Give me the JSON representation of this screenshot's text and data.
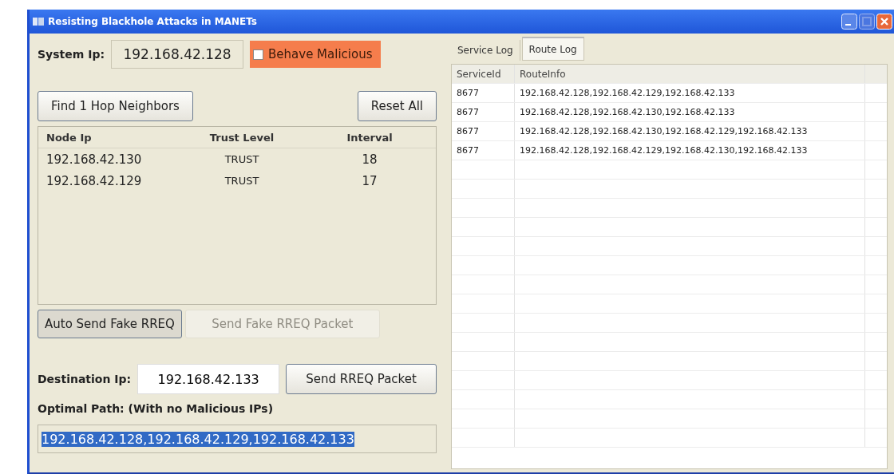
{
  "window": {
    "title": "Resisting Blackhole Attacks in MANETs"
  },
  "system_ip": {
    "label": "System Ip:",
    "value": "192.168.42.128"
  },
  "behave_malicious": {
    "label": "Behave Malicious",
    "checked": false
  },
  "buttons_top": [
    {
      "label": "Find 1 Hop Neighbors",
      "disabled": false
    },
    {
      "label": "Reset All",
      "disabled": false
    }
  ],
  "neighbors": {
    "columns": [
      "Node Ip",
      "Trust Level",
      "Interval"
    ],
    "rows": [
      [
        "192.168.42.130",
        "TRUST",
        "18"
      ],
      [
        "192.168.42.129",
        "TRUST",
        "17"
      ]
    ]
  },
  "buttons_fake": [
    {
      "label": "Auto Send Fake RREQ",
      "disabled": false
    },
    {
      "label": "Send Fake RREQ Packet",
      "disabled": true
    }
  ],
  "destination": {
    "label": "Destination Ip:",
    "value": "192.168.42.133",
    "button": "Send RREQ Packet"
  },
  "optimal_path": {
    "label": "Optimal Path: (With no Malicious IPs)",
    "value": "192.168.42.128,192.168.42.129,192.168.42.133",
    "selected": true
  },
  "tabs": [
    {
      "label": "Service Log",
      "selected": false
    },
    {
      "label": "Route Log",
      "selected": true
    }
  ],
  "route_log": {
    "columns": [
      "ServiceId",
      "RouteInfo"
    ],
    "rows": [
      [
        "8677",
        "192.168.42.128,192.168.42.129,192.168.42.133"
      ],
      [
        "8677",
        "192.168.42.128,192.168.42.130,192.168.42.133"
      ],
      [
        "8677",
        "192.168.42.128,192.168.42.130,192.168.42.129,192.168.42.133"
      ],
      [
        "8677",
        "192.168.42.128,192.168.42.129,192.168.42.130,192.168.42.133"
      ]
    ]
  }
}
